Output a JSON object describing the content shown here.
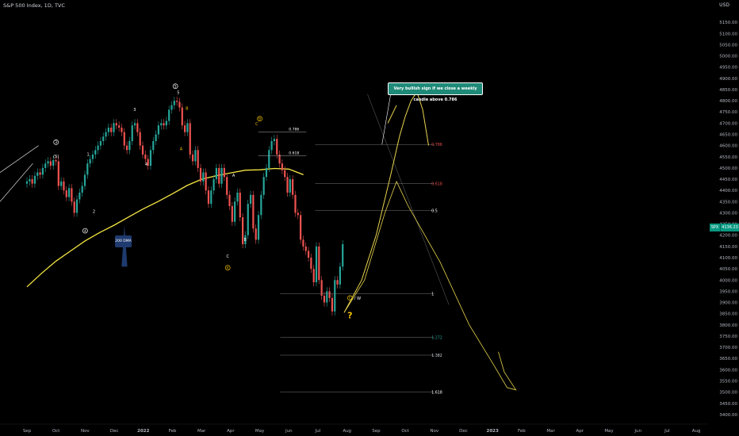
{
  "header": {
    "title": "S&P 500 Index, 1D, TVC",
    "currency": "USD"
  },
  "chart_data": {
    "type": "candlestick",
    "symbol_badge": "SPX",
    "last_price": "4136.23",
    "ylim": [
      3375,
      5200
    ],
    "y_ticks": [
      3400,
      3450,
      3500,
      3550,
      3600,
      3650,
      3700,
      3750,
      3800,
      3850,
      3900,
      3950,
      4000,
      4050,
      4100,
      4150,
      4200,
      4250,
      4300,
      4350,
      4400,
      4450,
      4500,
      4550,
      4600,
      4650,
      4700,
      4750,
      4800,
      4850,
      4900,
      4950,
      5000,
      5050,
      5100,
      5150
    ],
    "x_tick_labels": [
      "Sep",
      "Oct",
      "Nov",
      "Dec",
      "2022",
      "Feb",
      "Mar",
      "Apr",
      "May",
      "Jun",
      "Jul",
      "Aug",
      "Sep",
      "Oct",
      "Nov",
      "Dec",
      "2023",
      "Feb",
      "Mar",
      "Apr",
      "May",
      "Jun",
      "Jul",
      "Aug"
    ],
    "moving_average_label": "200 DMA",
    "annotation": "Very bullish sign if we close a weekly candle above 0.786",
    "question_mark": "?",
    "wave_labels": [
      {
        "text": "(5)",
        "t": 1.0,
        "price": 4545
      },
      {
        "text": "5",
        "t": 5.2,
        "price": 4830
      },
      {
        "text": "3",
        "t": 3.7,
        "price": 4755
      },
      {
        "text": "1",
        "t": 2.1,
        "price": 4555
      },
      {
        "text": "4",
        "t": 4.1,
        "price": 4510
      },
      {
        "text": "2",
        "t": 2.3,
        "price": 4300
      },
      {
        "text": "A",
        "t": 5.3,
        "price": 4580
      },
      {
        "text": "B",
        "t": 5.5,
        "price": 4760
      },
      {
        "text": "C",
        "t": 7.9,
        "price": 4690
      },
      {
        "text": "A",
        "t": 7.1,
        "price": 4460
      },
      {
        "text": "B",
        "t": 7.5,
        "price": 4175
      },
      {
        "text": "C",
        "t": 6.9,
        "price": 4100
      }
    ],
    "circled_labels": [
      {
        "text": "3",
        "t": 1.0,
        "price": 4615,
        "color": "#ffffff"
      },
      {
        "text": "4",
        "t": 2.0,
        "price": 4220,
        "color": "#ffffff"
      },
      {
        "text": "5",
        "t": 5.1,
        "price": 4865,
        "color": "#ffffff"
      },
      {
        "text": "B",
        "t": 8.0,
        "price": 4720,
        "color": "#f0c000"
      },
      {
        "text": "A",
        "t": 6.9,
        "price": 4055,
        "color": "#f0c000"
      },
      {
        "text": "C",
        "t": 11.1,
        "price": 3920,
        "color": "#f0c000"
      }
    ],
    "w_label": "/ W",
    "fib_upper": [
      {
        "label": "0.786",
        "price": 4660
      },
      {
        "label": "0.618",
        "price": 4555
      }
    ],
    "fib_projection": [
      {
        "label": "0.786",
        "price": 4605,
        "color": "#e84c4c"
      },
      {
        "label": "0.618",
        "price": 4430,
        "color": "#e84c4c"
      },
      {
        "label": "0.5",
        "price": 4310,
        "color": "#ffffff"
      },
      {
        "label": "1",
        "price": 3940,
        "color": "#ffffff"
      },
      {
        "label": "1.272",
        "price": 3745,
        "color": "#26a69a"
      },
      {
        "label": "1.382",
        "price": 3665,
        "color": "#d1d4dc"
      },
      {
        "label": "1.618",
        "price": 3500,
        "color": "#ffffff"
      }
    ],
    "ma200": [
      [
        0,
        3970
      ],
      [
        0.5,
        4030
      ],
      [
        1,
        4085
      ],
      [
        1.5,
        4130
      ],
      [
        2,
        4175
      ],
      [
        2.5,
        4212
      ],
      [
        3,
        4245
      ],
      [
        3.5,
        4282
      ],
      [
        4,
        4318
      ],
      [
        4.5,
        4350
      ],
      [
        5,
        4385
      ],
      [
        5.5,
        4422
      ],
      [
        6,
        4450
      ],
      [
        6.5,
        4465
      ],
      [
        7,
        4478
      ],
      [
        7.5,
        4490
      ],
      [
        8,
        4492
      ],
      [
        8.5,
        4498
      ],
      [
        9,
        4495
      ],
      [
        9.5,
        4470
      ]
    ],
    "candles_close": [
      4440,
      4450,
      4430,
      4465,
      4480,
      4470,
      4500,
      4520,
      4530,
      4510,
      4535,
      4530,
      4420,
      4440,
      4400,
      4370,
      4410,
      4350,
      4300,
      4360,
      4390,
      4420,
      4470,
      4520,
      4540,
      4560,
      4580,
      4600,
      4620,
      4640,
      4660,
      4680,
      4660,
      4700,
      4690,
      4680,
      4660,
      4600,
      4580,
      4620,
      4690,
      4700,
      4660,
      4600,
      4560,
      4540,
      4510,
      4580,
      4620,
      4650,
      4690,
      4700,
      4690,
      4710,
      4760,
      4780,
      4800,
      4795,
      4770,
      4690,
      4660,
      4700,
      4560,
      4530,
      4580,
      4500,
      4440,
      4480,
      4400,
      4340,
      4400,
      4450,
      4500,
      4430,
      4500,
      4460,
      4380,
      4330,
      4260,
      4350,
      4390,
      4280,
      4160,
      4200,
      4340,
      4380,
      4230,
      4180,
      4290,
      4380,
      4460,
      4500,
      4580,
      4620,
      4630,
      4560,
      4520,
      4490,
      4460,
      4390,
      4450,
      4380,
      4300,
      4290,
      4180,
      4150,
      4130,
      4100,
      4050,
      3990,
      4150,
      4000,
      3930,
      3900,
      3950,
      3920,
      3860,
      4000,
      3980,
      4060,
      4160
    ],
    "scenario_up": [
      [
        10.9,
        3855
      ],
      [
        11.5,
        4000
      ],
      [
        12,
        4200
      ],
      [
        12.5,
        4470
      ],
      [
        12.8,
        4640
      ],
      [
        13,
        4730
      ],
      [
        13.2,
        4800
      ],
      [
        13.4,
        4840
      ],
      [
        13.6,
        4760
      ],
      [
        13.8,
        4600
      ]
    ],
    "scenario_up_tail": [
      [
        12.4,
        4700
      ],
      [
        12.7,
        4780
      ]
    ],
    "scenario_down": [
      [
        10.9,
        3855
      ],
      [
        11.6,
        4000
      ],
      [
        12.3,
        4300
      ],
      [
        12.7,
        4440
      ],
      [
        13.1,
        4330
      ],
      [
        14.2,
        4080
      ],
      [
        15.2,
        3800
      ],
      [
        16,
        3630
      ],
      [
        16.5,
        3520
      ],
      [
        16.8,
        3510
      ],
      [
        16.4,
        3590
      ],
      [
        16.2,
        3680
      ]
    ]
  }
}
